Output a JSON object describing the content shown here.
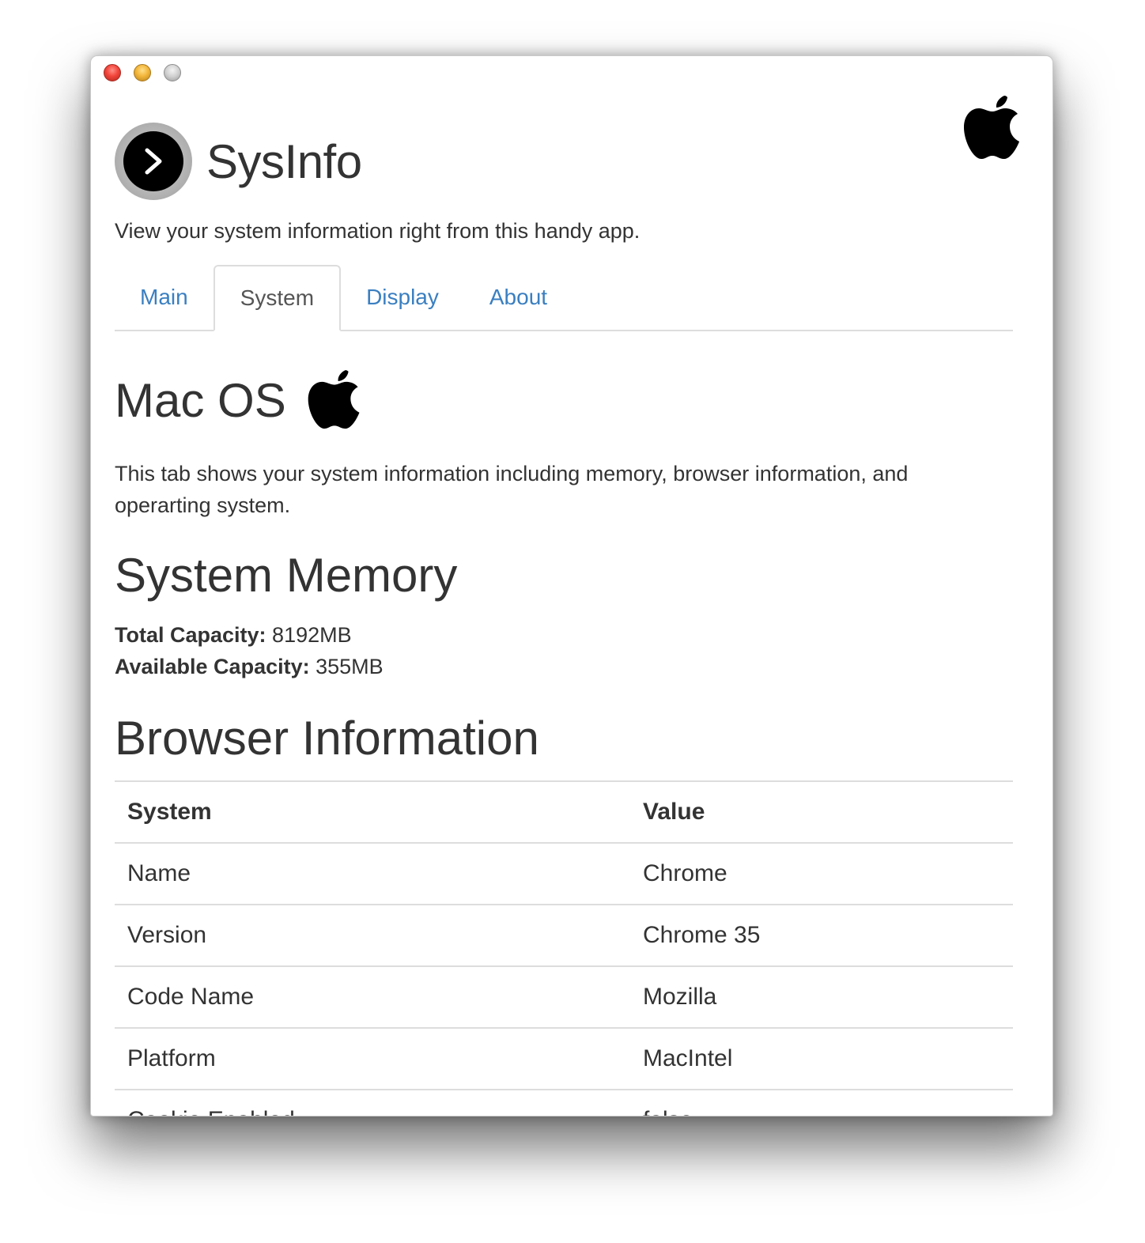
{
  "app": {
    "title": "SysInfo",
    "subtitle": "View your system information right from this handy app."
  },
  "tabs": [
    {
      "label": "Main",
      "active": false
    },
    {
      "label": "System",
      "active": true
    },
    {
      "label": "Display",
      "active": false
    },
    {
      "label": "About",
      "active": false
    }
  ],
  "system_tab": {
    "os_heading": "Mac OS",
    "description": "This tab shows your system information including memory, browser information, and operarting system.",
    "memory_heading": "System Memory",
    "total_label": "Total Capacity:",
    "total_value": "8192MB",
    "available_label": "Available Capacity:",
    "available_value": "355MB",
    "browser_heading": "Browser Information",
    "table": {
      "headers": [
        "System",
        "Value"
      ],
      "rows": [
        [
          "Name",
          "Chrome"
        ],
        [
          "Version",
          "Chrome 35"
        ],
        [
          "Code Name",
          "Mozilla"
        ],
        [
          "Platform",
          "MacIntel"
        ],
        [
          "Cookie Enabled",
          "false"
        ]
      ]
    }
  },
  "icons": {
    "app_logo": "chevron-right-icon",
    "os_logo": "apple-icon"
  },
  "colors": {
    "link": "#3a7fc1",
    "text": "#333333",
    "border": "#dddddd"
  }
}
